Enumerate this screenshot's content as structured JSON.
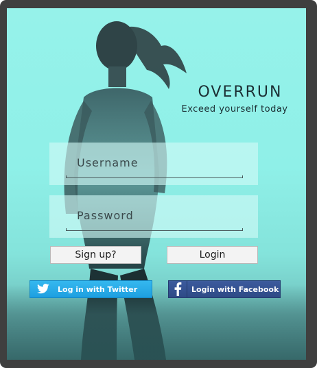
{
  "brand": {
    "title": "OVERRUN",
    "tagline": "Exceed yourself today"
  },
  "form": {
    "username_placeholder": "Username",
    "username_value": "",
    "password_placeholder": "Password",
    "password_value": ""
  },
  "buttons": {
    "signup_label": "Sign up?",
    "login_label": "Login"
  },
  "social": {
    "twitter_label": "Log in with Twitter",
    "twitter_icon": "twitter-bird-icon",
    "facebook_label": "Login with Facebook",
    "facebook_icon": "facebook-f-icon"
  },
  "colors": {
    "background": "#96f2ea",
    "twitter": "#1e9fe0",
    "facebook": "#3b5998",
    "device_frame": "#3f3f3f"
  }
}
